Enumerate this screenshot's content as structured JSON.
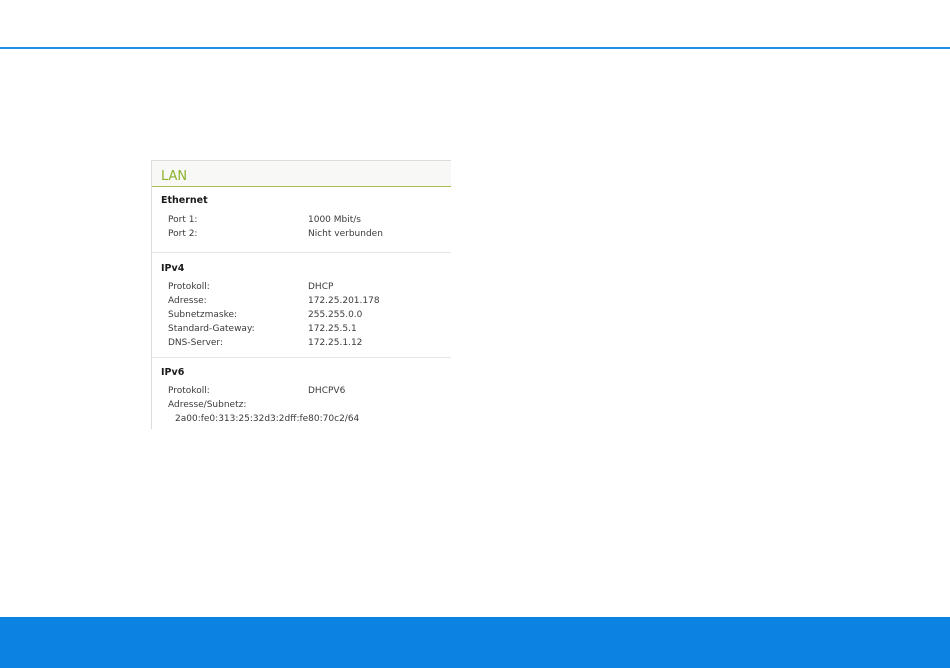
{
  "panel": {
    "title": "LAN",
    "ethernet": {
      "heading": "Ethernet",
      "rows": [
        {
          "label": "Port 1:",
          "value": "1000 Mbit/s"
        },
        {
          "label": "Port 2:",
          "value": "Nicht verbunden"
        }
      ]
    },
    "ipv4": {
      "heading": "IPv4",
      "rows": [
        {
          "label": "Protokoll:",
          "value": "DHCP"
        },
        {
          "label": "Adresse:",
          "value": "172.25.201.178"
        },
        {
          "label": "Subnetzmaske:",
          "value": "255.255.0.0"
        },
        {
          "label": "Standard-Gateway:",
          "value": "172.25.5.1"
        },
        {
          "label": "DNS-Server:",
          "value": "172.25.1.12"
        }
      ]
    },
    "ipv6": {
      "heading": "IPv6",
      "protocol_label": "Protokoll:",
      "protocol_value": "DHCPV6",
      "address_label": "Adresse/Subnetz:",
      "address_value": "2a00:fe0:313:25:32d3:2dff:fe80:70c2/64"
    }
  },
  "colors": {
    "accent_green": "#8cb12c",
    "top_rule_blue": "#1e8fe1",
    "bottom_bar_blue": "#0a83e2"
  }
}
